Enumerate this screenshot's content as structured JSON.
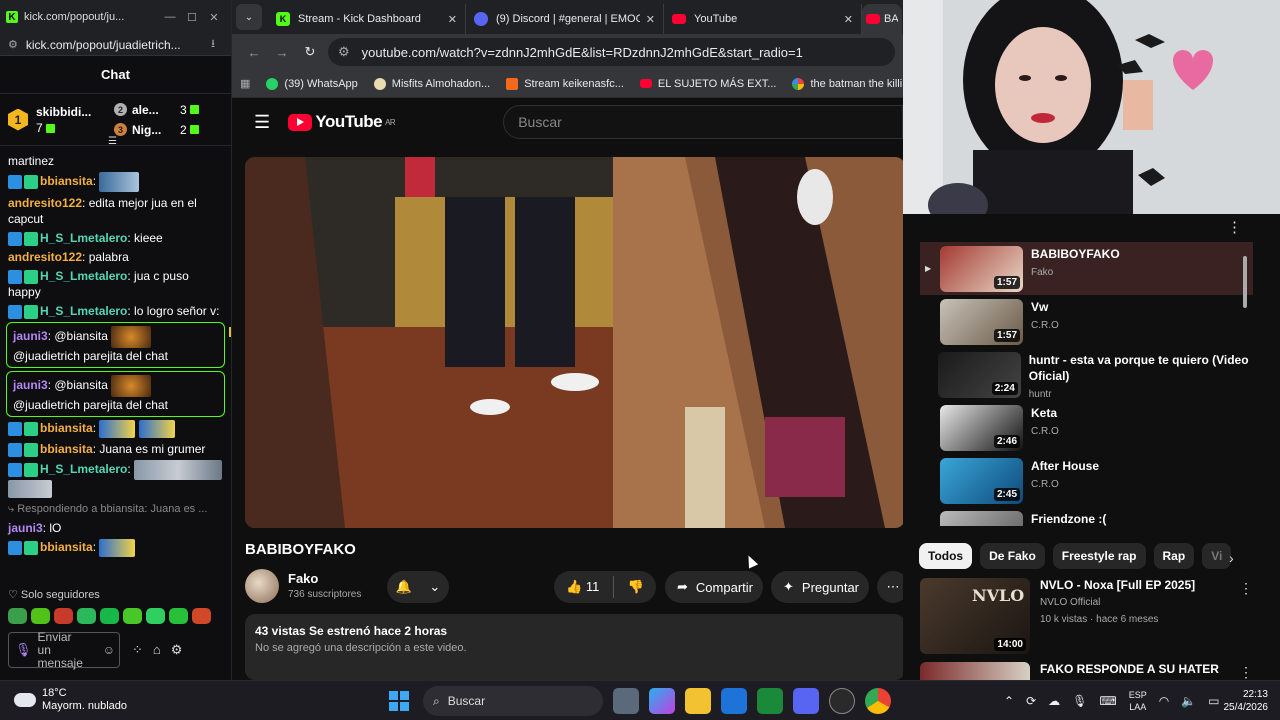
{
  "kick": {
    "window_title": "kick.com/popout/ju...",
    "url": "kick.com/popout/juadietrich...",
    "chat_header": "Chat",
    "leaderboard": {
      "first": {
        "rank": "1",
        "name": "skibbidi...",
        "count": "7"
      },
      "second": {
        "rank": "2",
        "name": "ale...",
        "count": "3"
      },
      "third": {
        "rank": "3",
        "name": "Nig...",
        "count": "2"
      }
    },
    "messages": [
      {
        "user": "",
        "text": "martinez"
      },
      {
        "user": "bbiansita",
        "text": ":"
      },
      {
        "user": "andresito122",
        "text": ": edita mejor jua en el capcut"
      },
      {
        "user": "H_S_Lmetalero",
        "text": ": kieee"
      },
      {
        "user": "andresito122",
        "text": ": palabra"
      },
      {
        "user": "H_S_Lmetalero",
        "text": ": jua c puso happy"
      },
      {
        "user": "H_S_Lmetalero",
        "text": ": lo logro señor v:"
      },
      {
        "user": "jauni3",
        "text": ": @biansita",
        "text2": "@juadietrich parejita del chat"
      },
      {
        "user": "jauni3",
        "text": ": @biansita",
        "text2": "@juadietrich parejita del chat"
      },
      {
        "user": "bbiansita",
        "text": ":"
      },
      {
        "user": "bbiansita",
        "text": ": Juana es mi grumer"
      },
      {
        "user": "H_S_Lmetalero",
        "text": ":"
      },
      {
        "user": "",
        "text": "Respondiendo a bbiansita: Juana es ..."
      },
      {
        "user": "jauni3",
        "text": ": lO"
      },
      {
        "user": "bbiansita",
        "text": ":"
      }
    ],
    "followers_only": "Solo seguidores",
    "send_placeholder": "Enviar un mensaje"
  },
  "browser": {
    "tabs": [
      {
        "title": "Stream - Kick Dashboard",
        "close": "✕"
      },
      {
        "title": "(9) Discord | #general | EMOGA...",
        "close": "✕"
      },
      {
        "title": "YouTube",
        "close": "✕"
      },
      {
        "title": "BAB",
        "close": ""
      }
    ],
    "url": "youtube.com/watch?v=zdnnJ2mhGdE&list=RDzdnnJ2mhGdE&start_radio=1",
    "bookmarks": [
      "(39) WhatsApp",
      "Misfits Almohadon...",
      "Stream keikenasfc...",
      "EL SUJETO MÁS EXT...",
      "the batman the killi..."
    ]
  },
  "youtube": {
    "logo": "YouTube",
    "region": "AR",
    "search_placeholder": "Buscar",
    "video_title": "BABIBOYFAKO",
    "channel": {
      "name": "Fako",
      "subs": "736 suscriptores"
    },
    "likes": "11",
    "share": "Compartir",
    "ask": "Preguntar",
    "desc_stats": "43 vistas  Se estrenó hace 2 horas",
    "desc_text": "No se agregó una descripción a este video.",
    "playlist": [
      {
        "title": "BABIBOYFAKO",
        "artist": "Fako",
        "dur": "1:57",
        "c1": "#a43a32",
        "c2": "#e8d9c8"
      },
      {
        "title": "Vw",
        "artist": "C.R.O",
        "dur": "1:57",
        "c1": "#c8c2b8",
        "c2": "#6a5a48"
      },
      {
        "title": "huntr - esta va porque te quiero (Video Oficial)",
        "artist": "huntr",
        "dur": "2:24",
        "c1": "#1a1a1a",
        "c2": "#444"
      },
      {
        "title": "Keta",
        "artist": "C.R.O",
        "dur": "2:46",
        "c1": "#e8e8e8",
        "c2": "#111"
      },
      {
        "title": "After House",
        "artist": "C.R.O",
        "dur": "2:45",
        "c1": "#3aa6d8",
        "c2": "#0e4a7a"
      },
      {
        "title": "Friendzone :(",
        "artist": "",
        "dur": "",
        "c1": "#bbb",
        "c2": "#555"
      }
    ],
    "chips": [
      "Todos",
      "De Fako",
      "Freestyle rap",
      "Rap",
      "Vi"
    ],
    "rec": {
      "title": "NVLO - Noxa [Full EP 2025]",
      "channel": "NVLO Official",
      "views": "10 k vistas · hace 6 meses",
      "dur": "14:00",
      "thumb_text": "NVLO"
    },
    "rec2": {
      "title": "FAKO RESPONDE A SU HATER"
    }
  },
  "taskbar": {
    "temp": "18°C",
    "weather": "Mayorm. nublado",
    "search": "Buscar",
    "lang1": "ESP",
    "lang2": "LAA",
    "time": "22:13",
    "date": "25/4/2026"
  }
}
